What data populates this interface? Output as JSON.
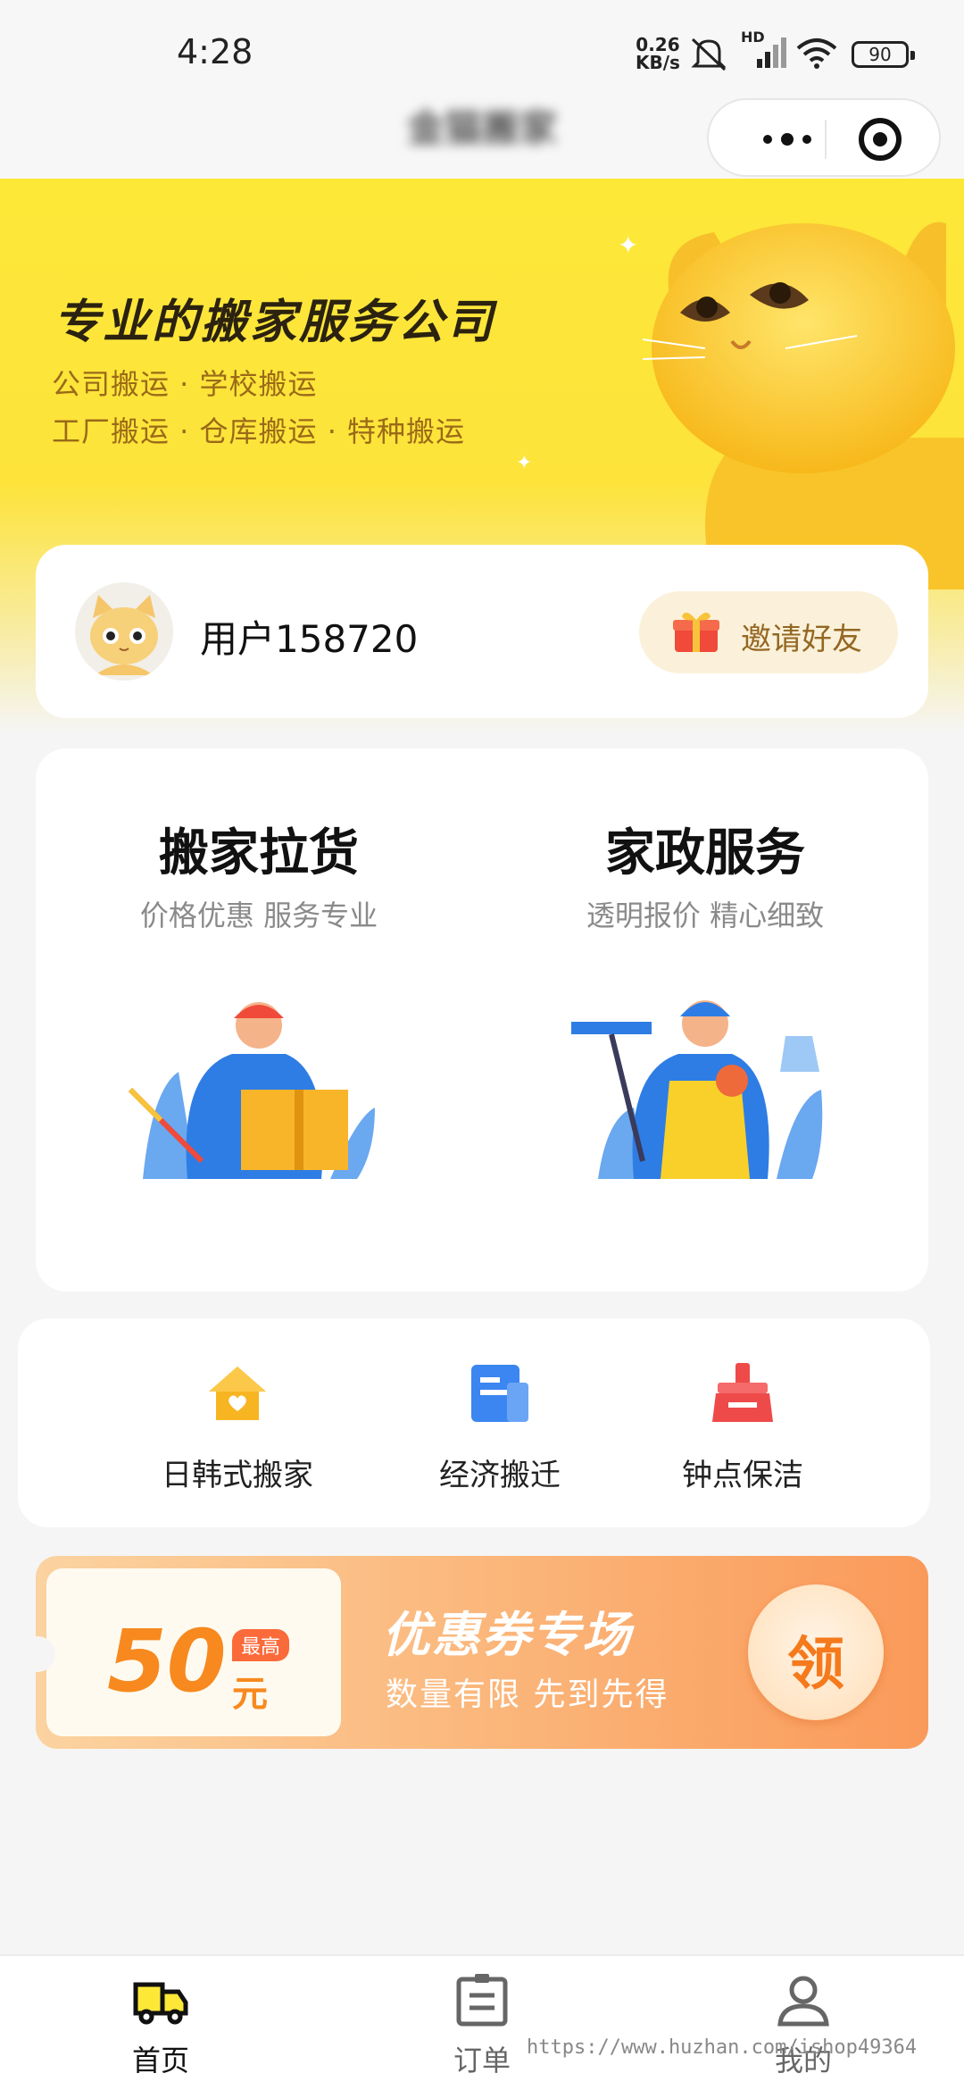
{
  "status_bar": {
    "time": "4:28",
    "net_speed_value": "0.26",
    "net_speed_unit": "KB/s",
    "hd_label": "HD",
    "battery": "90"
  },
  "nav": {
    "title": "金猫搬家"
  },
  "banner": {
    "title": "专业的搬家服务公司",
    "line1": "公司搬运 · 学校搬运",
    "line2": "工厂搬运 · 仓库搬运 · 特种搬运"
  },
  "user": {
    "name": "用户158720",
    "invite_label": "邀请好友"
  },
  "services": [
    {
      "title": "搬家拉货",
      "subtitle": "价格优惠 服务专业"
    },
    {
      "title": "家政服务",
      "subtitle": "透明报价 精心细致"
    }
  ],
  "quick_entries": [
    {
      "label": "日韩式搬家",
      "icon": "house-icon",
      "color": "#f7b521"
    },
    {
      "label": "经济搬迁",
      "icon": "document-icon",
      "color": "#3b86f0"
    },
    {
      "label": "钟点保洁",
      "icon": "broom-icon",
      "color": "#ef4a4a"
    }
  ],
  "coupon": {
    "amount": "50",
    "unit": "元",
    "max_badge": "最高",
    "title": "优惠券专场",
    "subtitle": "数量有限 先到先得",
    "claim_label": "领"
  },
  "tabs": [
    {
      "label": "首页",
      "icon": "truck-icon",
      "active": true
    },
    {
      "label": "订单",
      "icon": "order-icon",
      "active": false
    },
    {
      "label": "我的",
      "icon": "user-icon",
      "active": false
    }
  ],
  "watermark": "https://www.huzhan.com/ishop49364",
  "colors": {
    "brand_yellow": "#fde838",
    "coupon_orange": "#f7891e",
    "invite_bg": "#fbf1da"
  }
}
